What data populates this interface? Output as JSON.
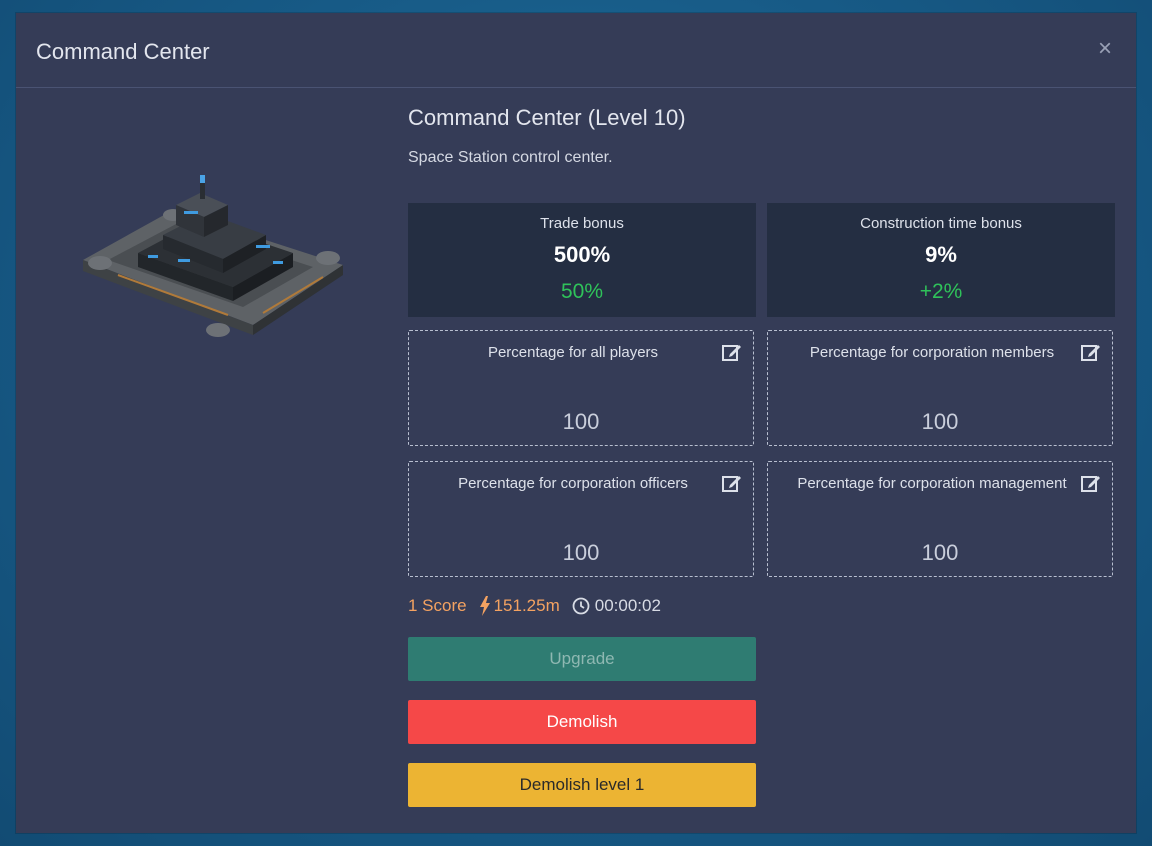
{
  "modal": {
    "title": "Command Center",
    "close_label": "×"
  },
  "building": {
    "title": "Command Center (Level 10)",
    "description": "Space Station control center."
  },
  "stats": [
    {
      "label": "Trade bonus",
      "value": "500%",
      "sub": "50%"
    },
    {
      "label": "Construction time bonus",
      "value": "9%",
      "sub": "+2%"
    }
  ],
  "percentages": [
    {
      "label": "Percentage for all players",
      "value": "100"
    },
    {
      "label": "Percentage for corporation members",
      "value": "100"
    },
    {
      "label": "Percentage for corporation officers",
      "value": "100"
    },
    {
      "label": "Percentage for corporation management",
      "value": "100"
    }
  ],
  "meta": {
    "score": "1 Score",
    "energy": "151.25m",
    "time": "00:00:02"
  },
  "buttons": {
    "upgrade": "Upgrade",
    "demolish": "Demolish",
    "demolish_level": "Demolish level 1"
  },
  "colors": {
    "positive": "#2fc25a",
    "accent_orange": "#f4a261",
    "upgrade": "#2f7c72",
    "demolish": "#f54848",
    "demolish_level": "#ecb433"
  }
}
